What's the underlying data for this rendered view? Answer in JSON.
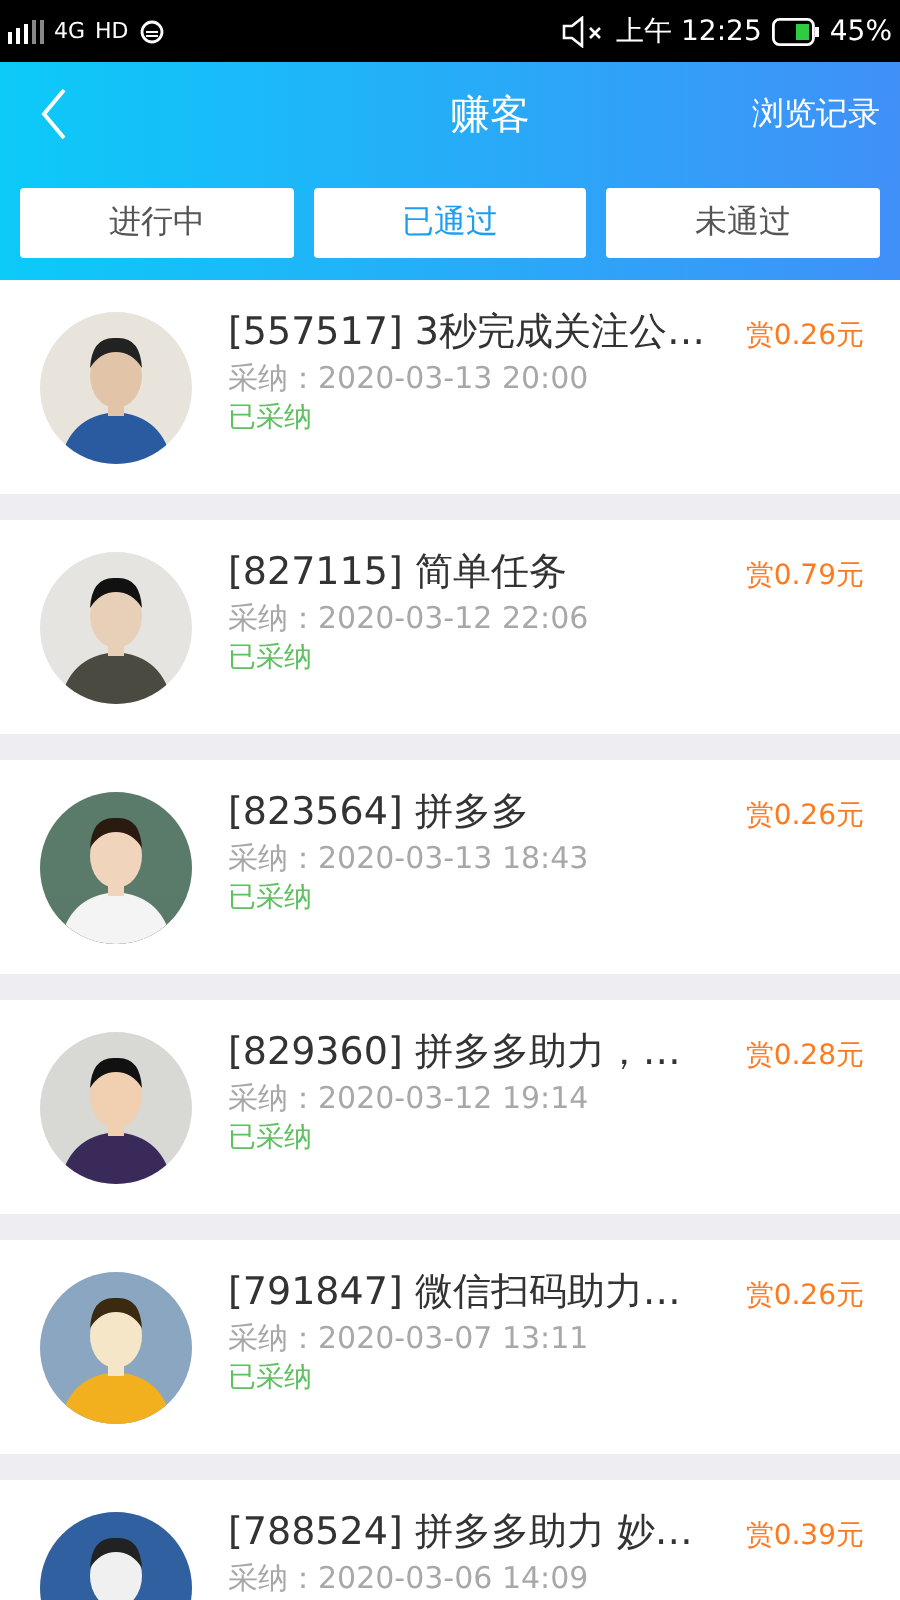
{
  "status_bar": {
    "network": "4G",
    "hd": "HD",
    "time": "上午 12:25",
    "battery": "45%"
  },
  "header": {
    "title": "赚客",
    "action": "浏览记录"
  },
  "tabs": [
    {
      "label": "进行中",
      "selected": false
    },
    {
      "label": "已通过",
      "selected": true
    },
    {
      "label": "未通过",
      "selected": false
    }
  ],
  "tasks": [
    {
      "title": "[557517] 3秒完成关注公…",
      "reward": "赏0.26元",
      "adopted": "采纳：2020-03-13 20:00",
      "status": "已采纳"
    },
    {
      "title": "[827115] 简单任务",
      "reward": "赏0.79元",
      "adopted": "采纳：2020-03-12 22:06",
      "status": "已采纳"
    },
    {
      "title": "[823564] 拼多多",
      "reward": "赏0.26元",
      "adopted": "采纳：2020-03-13 18:43",
      "status": "已采纳"
    },
    {
      "title": "[829360] 拼多多助力，…",
      "reward": "赏0.28元",
      "adopted": "采纳：2020-03-12 19:14",
      "status": "已采纳"
    },
    {
      "title": "[791847] 微信扫码助力…",
      "reward": "赏0.26元",
      "adopted": "采纳：2020-03-07 13:11",
      "status": "已采纳"
    },
    {
      "title": "[788524] 拼多多助力 妙…",
      "reward": "赏0.39元",
      "adopted": "采纳：2020-03-06 14:09"
    }
  ]
}
